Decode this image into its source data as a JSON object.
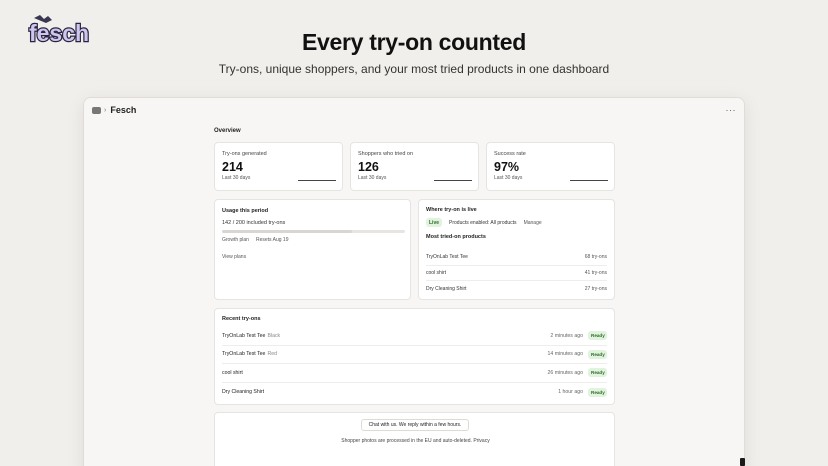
{
  "brand": {
    "logo_text": "fesch"
  },
  "hero": {
    "title": "Every try-on counted",
    "subtitle": "Try-ons, unique shoppers, and your most tried products in one dashboard"
  },
  "window": {
    "app_name": "Fesch",
    "more_label": "···"
  },
  "overview": {
    "title": "Overview",
    "metrics": [
      {
        "label": "Try-ons generated",
        "value": "214",
        "period": "Last 30 days"
      },
      {
        "label": "Shoppers who tried on",
        "value": "126",
        "period": "Last 30 days"
      },
      {
        "label": "Success rate",
        "value": "97%",
        "period": "Last 30 days"
      }
    ]
  },
  "usage": {
    "title": "Usage this period",
    "count_text": "142 / 200 included try-ons",
    "used": 142,
    "included": 200,
    "plan": "Growth plan",
    "resets": "Resets Aug 19",
    "view_plans": "View plans"
  },
  "live": {
    "title": "Where try-on is live",
    "badge": "Live",
    "products_enabled": "Products enabled: All products",
    "manage": "Manage",
    "most_tried_title": "Most tried-on products",
    "products": [
      {
        "name": "TryOnLab Test Tee",
        "count": "68 try-ons"
      },
      {
        "name": "cool shirt",
        "count": "41 try-ons"
      },
      {
        "name": "Dry Cleaning Shirt",
        "count": "27 try-ons"
      }
    ]
  },
  "recent": {
    "title": "Recent try-ons",
    "rows": [
      {
        "product": "TryOnLab Test Tee",
        "variant": "Black",
        "time": "2 minutes ago",
        "status": "Ready"
      },
      {
        "product": "TryOnLab Test Tee",
        "variant": "Red",
        "time": "14 minutes ago",
        "status": "Ready"
      },
      {
        "product": "cool shirt",
        "variant": "",
        "time": "26 minutes ago",
        "status": "Ready"
      },
      {
        "product": "Dry Cleaning Shirt",
        "variant": "",
        "time": "1 hour ago",
        "status": "Ready"
      }
    ]
  },
  "footer": {
    "chat": "Chat with us. We reply within a few hours.",
    "privacy": "Shopper photos are processed in the EU and auto-deleted. Privacy"
  },
  "colors": {
    "background": "#f1efeb",
    "ready_bg": "#e1f3de",
    "ready_text": "#2c6b25"
  }
}
